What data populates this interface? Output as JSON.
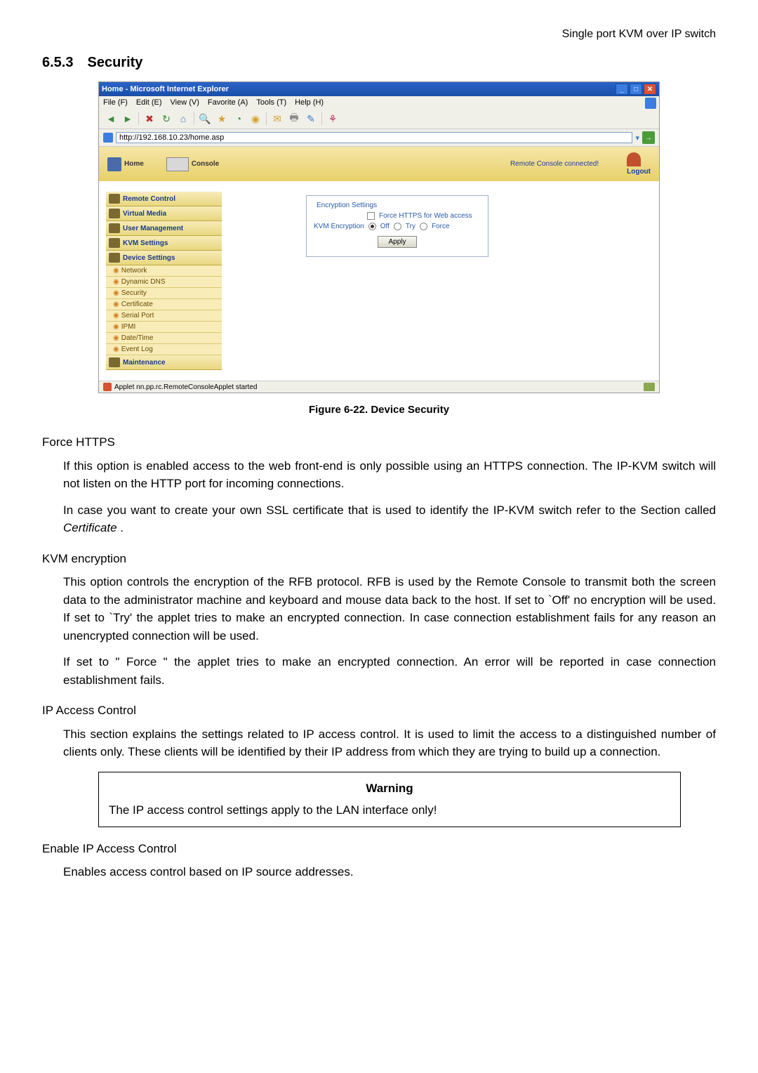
{
  "header": {
    "product": "Single port KVM over IP switch"
  },
  "section": {
    "number": "6.5.3",
    "title": "Security"
  },
  "browser": {
    "title": "Home - Microsoft Internet Explorer",
    "menus": {
      "file": "File (F)",
      "edit": "Edit (E)",
      "view": "View (V)",
      "favorite": "Favorite (A)",
      "tools": "Tools (T)",
      "help": "Help (H)"
    },
    "url": "http://192.168.10.23/home.asp",
    "status": "Applet nn.pp.rc.RemoteConsoleApplet started"
  },
  "kvm": {
    "home": "Home",
    "console": "Console",
    "remote_status": "Remote Console connected!",
    "logout": "Logout",
    "sidebar": {
      "remote_control": "Remote Control",
      "virtual_media": "Virtual Media",
      "user_mgmt": "User Management",
      "kvm_settings": "KVM Settings",
      "device_settings": "Device Settings",
      "network": "Network",
      "dynamic_dns": "Dynamic DNS",
      "security": "Security",
      "certificate": "Certificate",
      "serial_port": "Serial Port",
      "ipmi": "IPMI",
      "date_time": "Date/Time",
      "event_log": "Event Log",
      "maintenance": "Maintenance"
    },
    "encryption": {
      "legend": "Encryption Settings",
      "force_https": "Force HTTPS for Web access",
      "kvm_enc_label": "KVM Encryption",
      "off": "Off",
      "try": "Try",
      "force": "Force",
      "apply": "Apply"
    }
  },
  "figure_caption": "Figure 6-22. Device Security",
  "doc": {
    "force_https_h": "Force HTTPS",
    "force_https_p1": "If this option is enabled access to the web front-end is only possible using an HTTPS connection. The IP-KVM switch will not listen on the HTTP port for incoming connections.",
    "force_https_p2a": "In case you want to create your own SSL certificate that is used to identify the IP-KVM switch refer to the Section called ",
    "force_https_p2b": "Certificate",
    "force_https_p2c": " .",
    "kvm_enc_h": "KVM encryption",
    "kvm_enc_p1": "This option controls the encryption of the RFB protocol. RFB is used by the Remote Console to transmit both the screen data to the administrator machine and keyboard and mouse data back to the host. If set to `Off' no encryption will be used. If set to `Try' the applet tries to make an encrypted connection. In case connection establishment fails for any reason an unencrypted connection will be used.",
    "kvm_enc_p2": "If set to \" Force \" the applet tries to make an encrypted connection. An error will be reported in case connection establishment fails.",
    "ip_access_h": "IP Access Control",
    "ip_access_p1": "This section explains the settings related to IP access control. It is used to limit the access to a distinguished number of clients only. These clients will be identified by their IP address from which they are trying to build up a connection.",
    "warning_title": "Warning",
    "warning_text": "The IP access control settings apply to the LAN interface only!",
    "enable_ip_h": "Enable IP Access Control",
    "enable_ip_p1": "Enables access control based on IP source addresses."
  }
}
